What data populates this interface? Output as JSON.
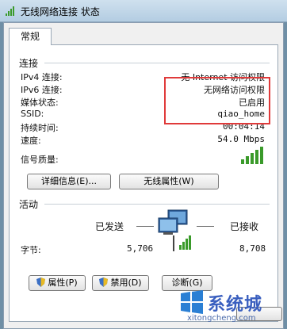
{
  "window": {
    "title": "无线网络连接 状态"
  },
  "tabs": [
    {
      "label": "常规"
    }
  ],
  "connection": {
    "section_label": "连接",
    "rows": [
      {
        "key": "IPv4 连接:",
        "value": "无 Internet 访问权限"
      },
      {
        "key": "IPv6 连接:",
        "value": "无网络访问权限"
      },
      {
        "key": "媒体状态:",
        "value": "已启用"
      },
      {
        "key": "SSID:",
        "value": "qiao_home"
      },
      {
        "key": "持续时间:",
        "value": "00:04:14"
      },
      {
        "key": "速度:",
        "value": "54.0 Mbps"
      }
    ],
    "signal_label": "信号质量:",
    "signal_level": "5/5"
  },
  "buttons": {
    "details": "详细信息(E)...",
    "wireless_props": "无线属性(W)",
    "properties": "属性(P)",
    "disable": "禁用(D)",
    "diagnose": "诊断(G)"
  },
  "activity": {
    "section_label": "活动",
    "sent_label": "已发送",
    "received_label": "已接收",
    "bytes_label": "字节:",
    "sent_bytes": "5,706",
    "received_bytes": "8,708"
  },
  "watermark": {
    "brand": "系统城",
    "url": "xitongcheng.com"
  },
  "colors": {
    "highlight_border": "#e03a3a",
    "signal_green": "#3a9a2a"
  }
}
